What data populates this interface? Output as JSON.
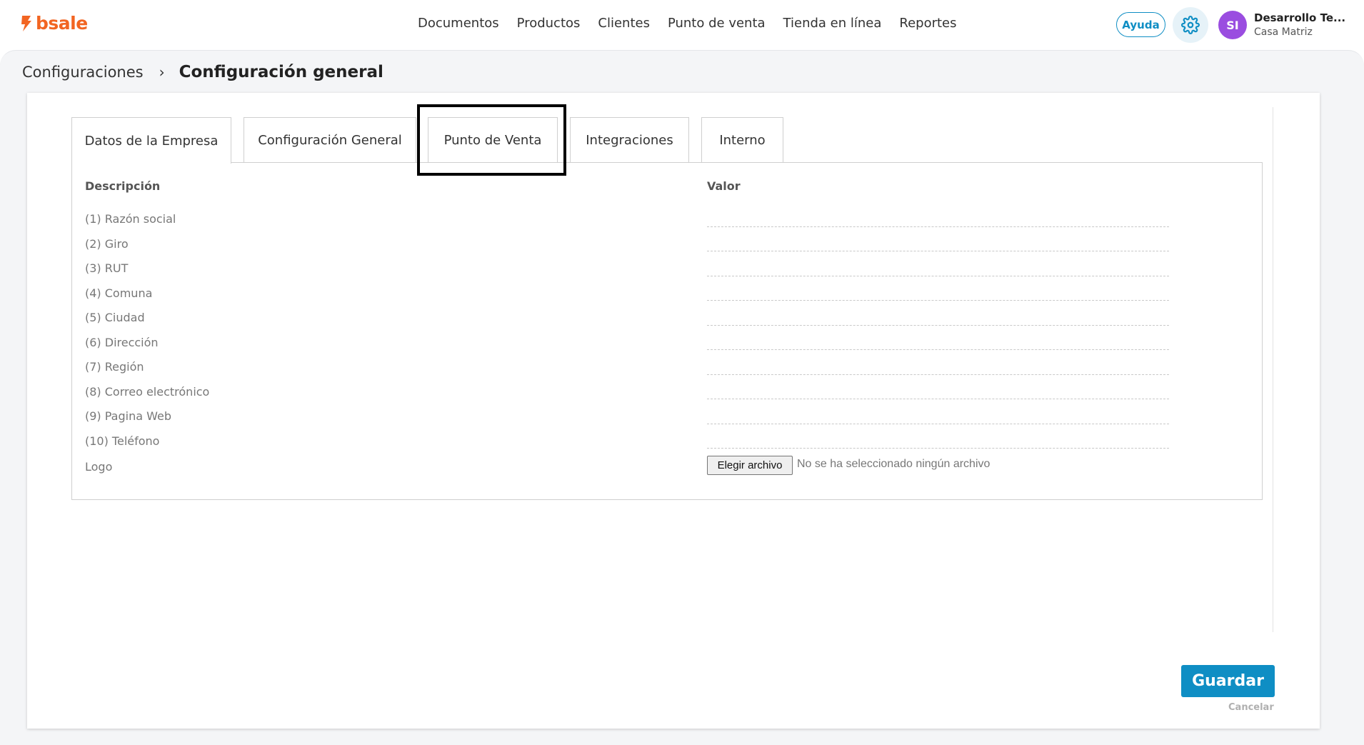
{
  "brand": {
    "logo_text": "bsale",
    "accent_color": "#f26522",
    "primary_color": "#0f8ec4"
  },
  "nav": [
    "Documentos",
    "Productos",
    "Clientes",
    "Punto de venta",
    "Tienda en línea",
    "Reportes"
  ],
  "header": {
    "help_label": "Ayuda",
    "avatar_initials": "SI",
    "user_name": "Desarrollo Te...",
    "user_branch": "Casa Matriz",
    "avatar_color": "#9a4de0"
  },
  "breadcrumb": {
    "parent": "Configuraciones",
    "separator": "›",
    "current": "Configuración general"
  },
  "tabs": [
    "Datos de la Empresa",
    "Configuración General",
    "Punto de Venta",
    "Integraciones",
    "Interno"
  ],
  "table": {
    "col_description": "Descripción",
    "col_value": "Valor",
    "rows": [
      "(1) Razón social",
      "(2) Giro",
      "(3) RUT",
      "(4) Comuna",
      "(5) Ciudad",
      "(6) Dirección",
      "(7) Región",
      "(8) Correo electrónico",
      "(9) Pagina Web",
      "(10) Teléfono"
    ],
    "logo_label": "Logo",
    "file_button": "Elegir archivo",
    "file_status": "No se ha seleccionado ningún archivo"
  },
  "actions": {
    "save": "Guardar",
    "cancel": "Cancelar"
  }
}
